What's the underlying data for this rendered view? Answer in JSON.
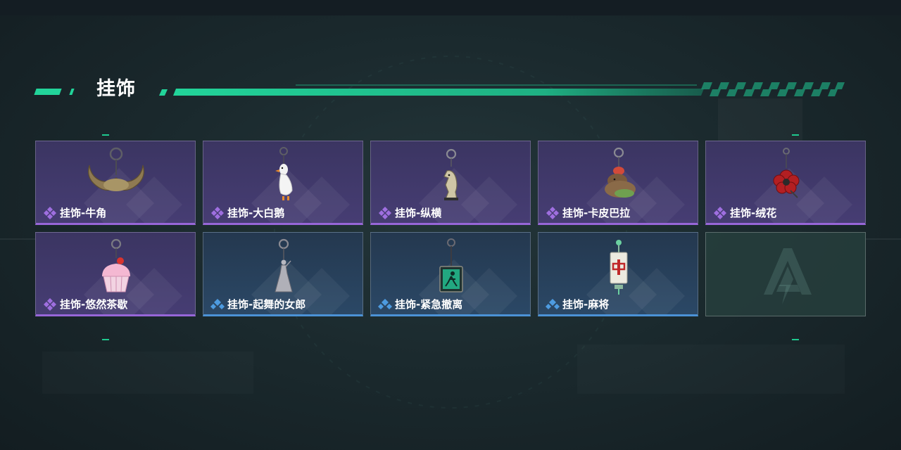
{
  "section": {
    "title": "挂饰"
  },
  "colors": {
    "accent": "#22d49a",
    "purple_rarity": "#9766d8",
    "blue_rarity": "#4b92d6",
    "purple_card": "#433a6c",
    "blue_card": "#28405c"
  },
  "items": [
    {
      "name": "挂饰-牛角",
      "rarity": "purple",
      "icon": "bull-horns-charm-icon"
    },
    {
      "name": "挂饰-大白鹅",
      "rarity": "purple",
      "icon": "white-goose-charm-icon"
    },
    {
      "name": "挂饰-纵横",
      "rarity": "purple",
      "icon": "chess-knight-charm-icon"
    },
    {
      "name": "挂饰-卡皮巴拉",
      "rarity": "purple",
      "icon": "capybara-charm-icon"
    },
    {
      "name": "挂饰-绒花",
      "rarity": "purple",
      "icon": "red-flower-charm-icon"
    },
    {
      "name": "挂饰-悠然茶歇",
      "rarity": "purple",
      "icon": "cupcake-charm-icon"
    },
    {
      "name": "挂饰-起舞的女郎",
      "rarity": "blue",
      "icon": "dancing-lady-charm-icon"
    },
    {
      "name": "挂饰-紧急撤离",
      "rarity": "blue",
      "icon": "exit-sign-charm-icon"
    },
    {
      "name": "挂饰-麻将",
      "rarity": "blue",
      "icon": "mahjong-tile-charm-icon"
    }
  ],
  "empty_slot": {
    "icon": "game-logo-icon"
  }
}
